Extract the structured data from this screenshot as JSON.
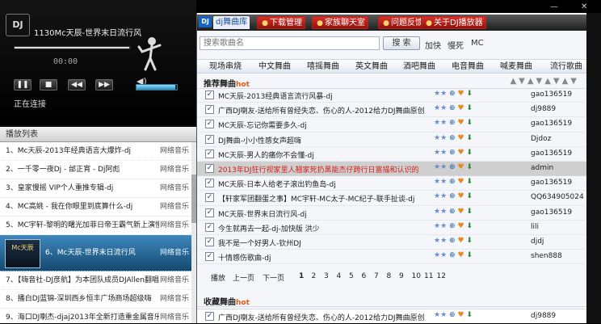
{
  "player": {
    "logo": "DJ",
    "title": "1130Mc天辰-世界末日流行风",
    "time": "00:00",
    "status": "正在连接",
    "seek_progress": 0.99,
    "volume_level": 0.96,
    "controls": {
      "play": "❚❚",
      "stop": "■",
      "prev": "◀◀",
      "next": "▶▶"
    }
  },
  "playlist": {
    "header": "播放列表",
    "items": [
      {
        "title": "1、Mc天辰-2013年经典语言大爆炸-dj",
        "source": "网络音乐"
      },
      {
        "title": "2、一千零一夜Dj - 邰正宵 - Dj阿彪",
        "source": "网络音乐"
      },
      {
        "title": "3、皇家慢摇 VIP个人重推专辑-dj",
        "source": "网络音乐"
      },
      {
        "title": "4、MC高姚 - 我在你眼里到底算什么-dj",
        "source": "网络音乐"
      },
      {
        "title": "5、MC宇轩-黎明的曙光加菲日帝王霸气新上演慢摇",
        "source": "网络音乐"
      },
      {
        "title": "6、Mc天辰-世界末日流行风",
        "source": "网络音乐",
        "playing": true,
        "cover": "Mc天辰"
      },
      {
        "title": "7、【嗨音社-DJ彦航】为本团队成员DJAllen翻唱新歌",
        "source": "网络音乐"
      },
      {
        "title": "8、播白DJ蓝锦-深圳西乡恒丰广场商场超级嗨",
        "source": "网络音乐"
      },
      {
        "title": "9、海口DJ喇杰-djaj2013年全新打造重金属音乐",
        "source": "网络音乐"
      }
    ]
  },
  "nav": {
    "badge": "DJ",
    "items": [
      {
        "label": "dj舞曲库",
        "active": true
      },
      {
        "label": "下载管理"
      },
      {
        "label": "家族聊天室"
      },
      {
        "label": "问题反馈"
      },
      {
        "label": "关于DJ播放器"
      }
    ]
  },
  "search": {
    "placeholder": "搜索歌曲名",
    "button": "搜 索",
    "quick": [
      "加快",
      "慢死",
      "MC"
    ]
  },
  "categories": [
    "现场串烧",
    "中文舞曲",
    "嘻摇舞曲",
    "英文舞曲",
    "酒吧舞曲",
    "电音舞曲",
    "喊麦舞曲",
    "流行歌曲"
  ],
  "recommend": {
    "label": "推荐舞曲",
    "hot": "hot",
    "songs": [
      {
        "name": "MC天辰-2013经典语言流行风暴-dj",
        "user": "gao136519"
      },
      {
        "name": "广西DJ喇友-送给所有曾经失恋、伤心的人-2012给力DJ舞曲原创",
        "user": "dj9889"
      },
      {
        "name": "MC天辰-忘记你需要多久-dj",
        "user": "gao136519"
      },
      {
        "name": "DJ舞曲-小小性感女声超嗨",
        "user": "Djdoz"
      },
      {
        "name": "MC天辰-男人的痛你不会懂-dj",
        "user": "gao136519"
      },
      {
        "name": "2013年DJ狂行视家里人翘家死扔黑能杰仔跨行日富描和认识的",
        "user": "admin",
        "selected": true
      },
      {
        "name": "MC天辰-日本人给老子滚出钓鱼岛-dj",
        "user": "gao136519"
      },
      {
        "name": "【轩家军团翻蛋之事】MC宇轩-MC太子-MC纪子-联手扯谈-dj",
        "user": "QQ634905024"
      },
      {
        "name": "MC天辰-世界末日流行风-dj",
        "user": "gao136519"
      },
      {
        "name": "今生就再去一起-dj-加快版 洪少",
        "user": "lili"
      },
      {
        "name": "我不是一个好男人-钦州DJ",
        "user": "djdj"
      },
      {
        "name": "十情感伤歌曲-dj",
        "user": "shen888"
      }
    ]
  },
  "pager": {
    "labels": [
      "播放",
      "上一页",
      "下一页"
    ],
    "pages": [
      "1",
      "2",
      "3",
      "4",
      "5",
      "6",
      "7",
      "8",
      "9",
      "10",
      "11",
      "12"
    ]
  },
  "favorites": {
    "label": "收藏舞曲",
    "song": {
      "name": "广西DJ喇友-送给所有曾经失恋、伤心的人-2012给力DJ舞曲原创",
      "user": "dj9889"
    }
  },
  "row_icons": {
    "stars": "★★",
    "hp": "⊕",
    "heart": "♥",
    "dl": "⬇"
  }
}
